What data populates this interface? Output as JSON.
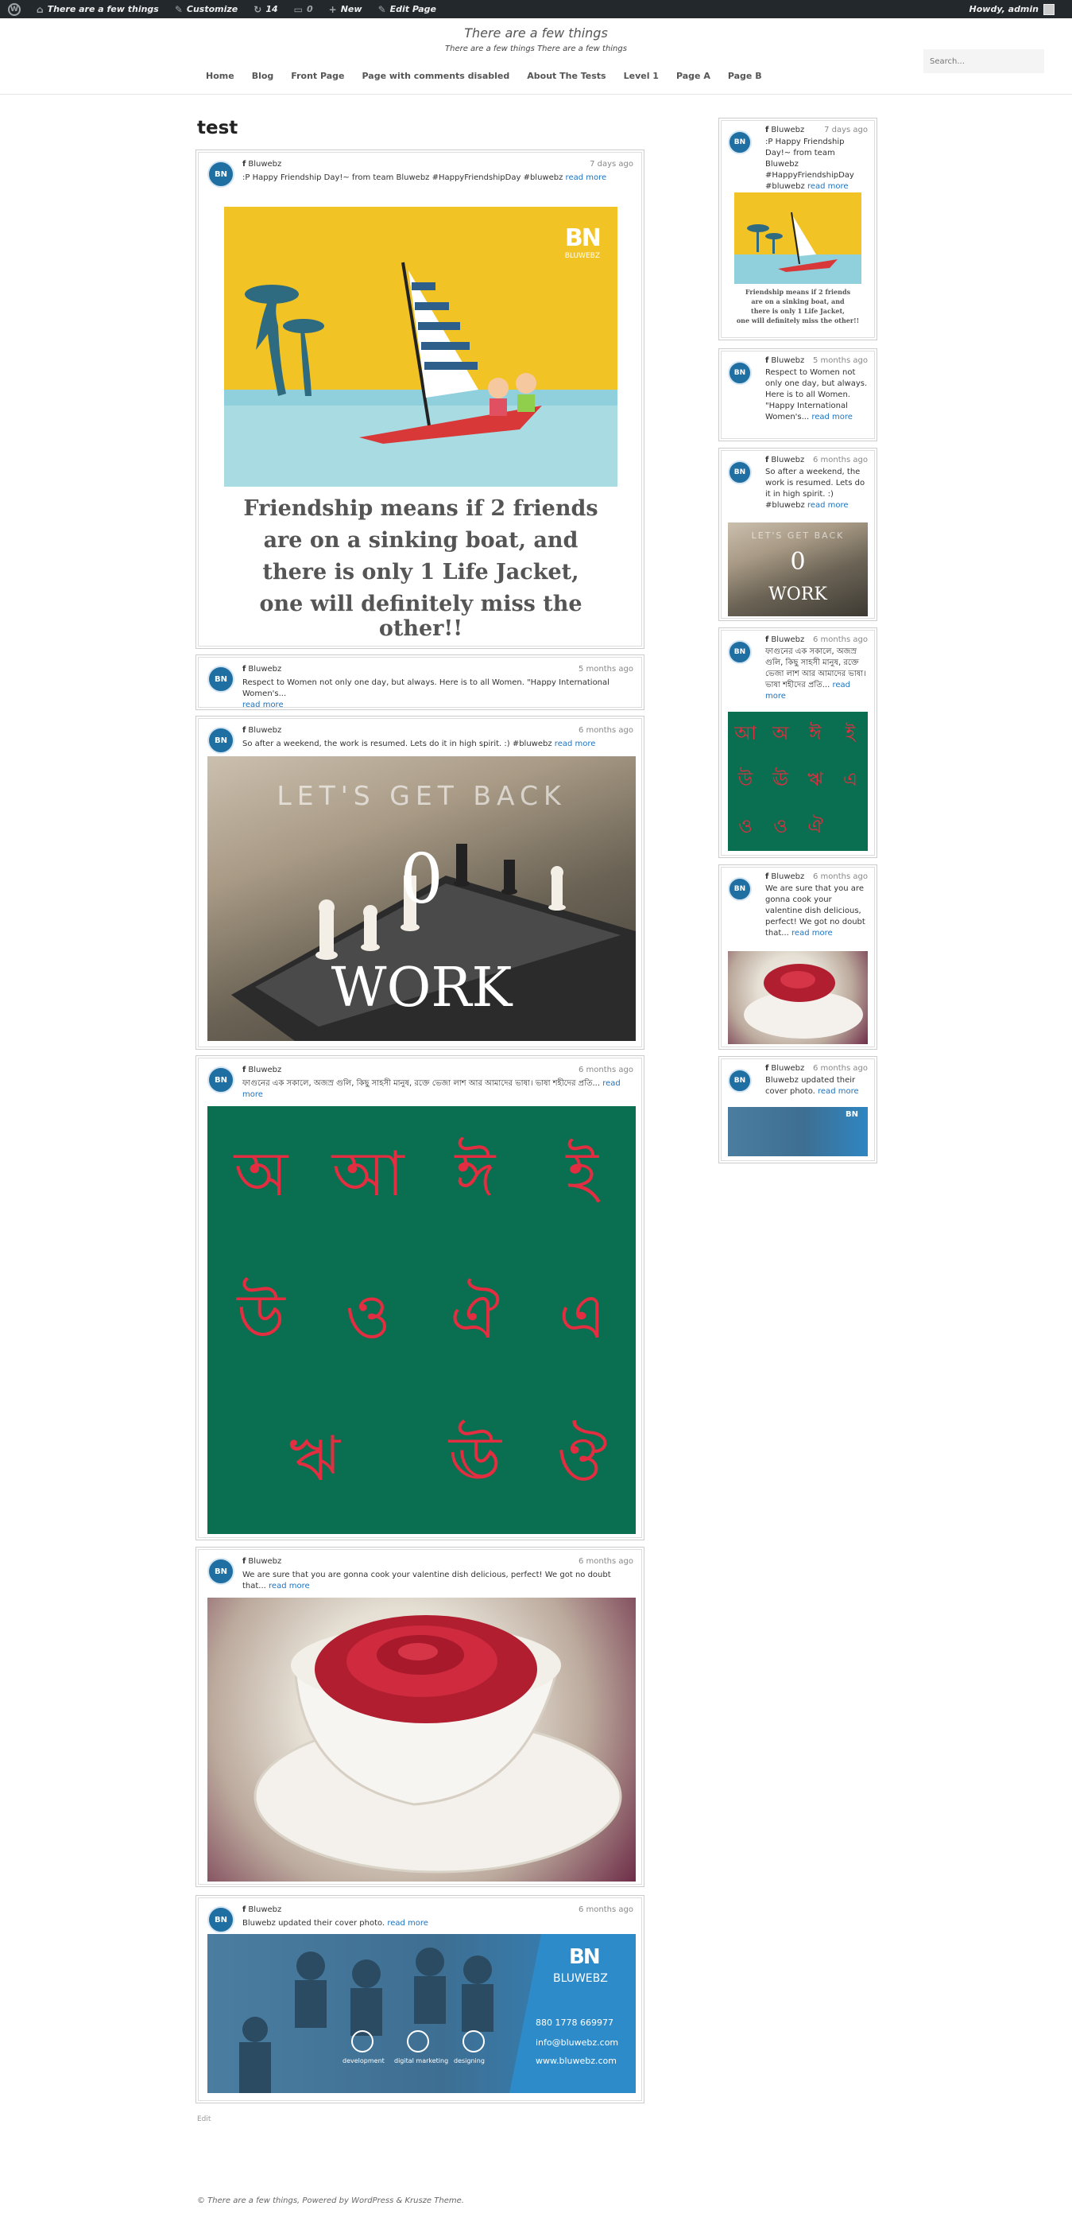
{
  "adminbar": {
    "site_name": "There are a few things",
    "customize": "Customize",
    "updates_count": "14",
    "comments_count": "0",
    "new": "New",
    "edit_page": "Edit Page",
    "howdy": "Howdy, admin"
  },
  "header": {
    "title": "There are a few things",
    "description": "There are a few things There are a few things",
    "search_placeholder": "Search..."
  },
  "nav": [
    "Home",
    "Blog",
    "Front Page",
    "Page with comments disabled",
    "About The Tests",
    "Level 1",
    "Page A",
    "Page B"
  ],
  "page": {
    "title": "test",
    "edit_label": "Edit"
  },
  "posts": [
    {
      "author": "Bluwebz",
      "time": "7 days ago",
      "message": ":P Happy Friendship Day!~ from team Bluwebz #HappyFriendshipDay #bluwebz",
      "more": "read more"
    },
    {
      "author": "Bluwebz",
      "time": "5 months ago",
      "message": "Respect to Women not only one day, but always. Here is to all Women. \"Happy International Women's...",
      "more": "read more"
    },
    {
      "author": "Bluwebz",
      "time": "6 months ago",
      "message": "So after a weekend, the work is resumed. Lets do it in high spirit. :) #bluwebz",
      "more": "read more"
    },
    {
      "author": "Bluwebz",
      "time": "6 months ago",
      "message": "ফাগুনের এক সকালে, অজস্র গুলি, কিছু সাহসী মানুষ, রক্তে ভেজা লাশ আর আমাদের ভাষা। ভাষা শহীদের প্রতি...",
      "more": "read more"
    },
    {
      "author": "Bluwebz",
      "time": "6 months ago",
      "message": "We are sure that you are gonna cook your valentine dish delicious, perfect! We got no doubt that...",
      "more": "read more"
    },
    {
      "author": "Bluwebz",
      "time": "6 months ago",
      "message": "Bluwebz updated their cover photo.",
      "more": "read more"
    }
  ],
  "images": {
    "friendship_lines": [
      "Friendship means if 2 friends",
      "are on a sinking boat, and",
      "there is only 1 Life Jacket,",
      "one will definitely miss the other!!"
    ],
    "brand": "BLUWEBZ",
    "logo": "BN",
    "chess_top": "LET'S GET BACK",
    "chess_num": "0",
    "chess_bottom": "WORK",
    "bangla_letters": [
      "অ",
      "আ",
      "ঈ",
      "ই",
      "উ",
      "ও",
      "ঐ",
      "এ",
      "ঋ",
      "ঊ",
      "ঔ"
    ],
    "cover_phone": "880 1778 669977",
    "cover_email": "info@bluwebz.com",
    "cover_web": "www.bluwebz.com",
    "cover_services": [
      "development",
      "digital marketing",
      "designing"
    ]
  },
  "footer": {
    "text": "© There are a few things, Powered by WordPress & Krusze Theme."
  },
  "avatar_text": "BN",
  "colors": {
    "accent": "#1e73be",
    "admin_bar": "#23282d",
    "brand_blue": "#1f6fa3"
  }
}
